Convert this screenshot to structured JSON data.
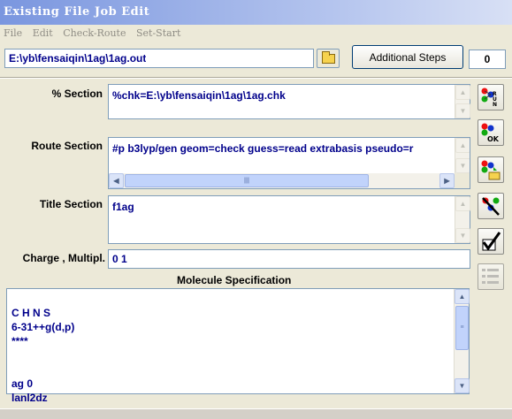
{
  "window": {
    "title": "Existing File Job Edit"
  },
  "menu": [
    "File",
    "Edit",
    "Check-Route",
    "Set-Start"
  ],
  "file": {
    "path": "E:\\yb\\fensaiqin\\1ag\\1ag.out",
    "additional_steps_label": "Additional Steps",
    "counter": "0"
  },
  "percent_section": {
    "label": "% Section",
    "value": "%chk=E:\\yb\\fensaiqin\\1ag\\1ag.chk"
  },
  "route_section": {
    "label": "Route Section",
    "value": "#p b3lyp/gen geom=check guess=read extrabasis pseudo=r"
  },
  "title_section": {
    "label": "Title Section",
    "value": "f1ag"
  },
  "charge": {
    "label": "Charge , Multipl.",
    "value": "0 1"
  },
  "molecule": {
    "label": "Molecule Specification",
    "lines": [
      "",
      "",
      "C H N S",
      "6-31++g(d,p)",
      "****",
      "",
      "",
      "ag 0",
      "lanl2dz"
    ]
  },
  "side_buttons": [
    "run-icon",
    "ok-icon",
    "save-icon",
    "delete-icon",
    "check-icon",
    "list-icon"
  ]
}
